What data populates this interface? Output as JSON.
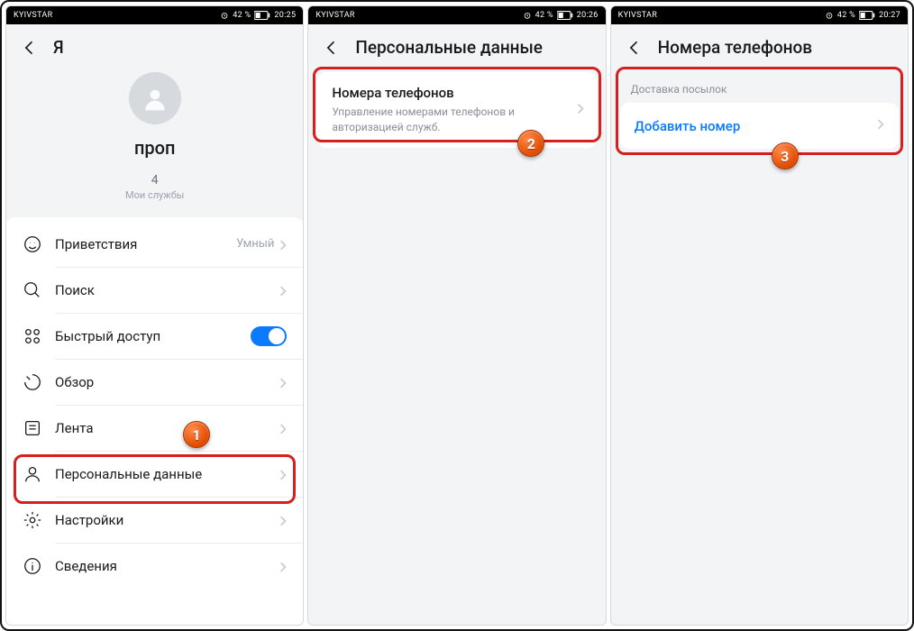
{
  "status": {
    "carrier": "KYIVSTAR",
    "battery": "42 %",
    "times": [
      "20:25",
      "20:26",
      "20:27"
    ]
  },
  "badges": {
    "n1": "1",
    "n2": "2",
    "n3": "3"
  },
  "screen1": {
    "title": "Я",
    "profile_name": "проп",
    "profile_count": "4",
    "profile_sub": "Мои службы",
    "rows": {
      "greet": {
        "label": "Приветствия",
        "value": "Умный"
      },
      "search": {
        "label": "Поиск"
      },
      "quick": {
        "label": "Быстрый доступ"
      },
      "overview": {
        "label": "Обзор"
      },
      "feed": {
        "label": "Лента"
      },
      "personal": {
        "label": "Персональные данные"
      },
      "settings": {
        "label": "Настройки"
      },
      "about": {
        "label": "Сведения"
      }
    }
  },
  "screen2": {
    "title": "Персональные данные",
    "card": {
      "title": "Номера телефонов",
      "sub": "Управление номерами телефонов и авторизацией служб."
    }
  },
  "screen3": {
    "title": "Номера телефонов",
    "section": "Доставка посылок",
    "link": "Добавить номер"
  }
}
